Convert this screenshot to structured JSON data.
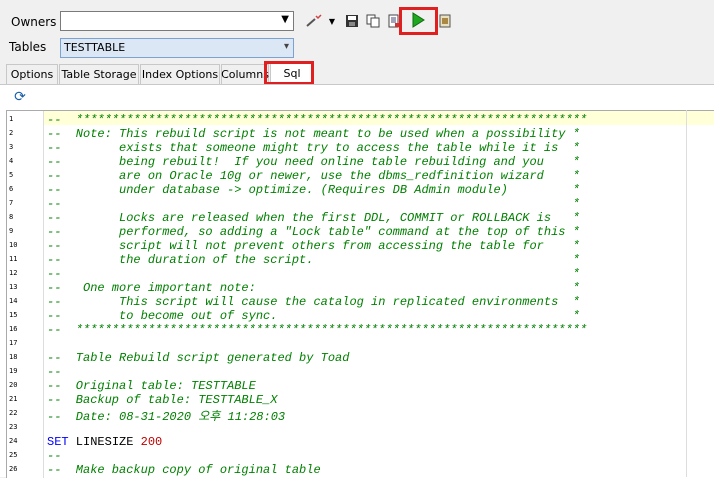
{
  "owners": {
    "label": "Owners",
    "value": ""
  },
  "tables": {
    "label": "Tables",
    "value": "TESTTABLE"
  },
  "tabs": [
    {
      "label": "Options"
    },
    {
      "label": "Table Storage"
    },
    {
      "label": "Index Options"
    },
    {
      "label": "Columns"
    },
    {
      "label": "Sql"
    }
  ],
  "active_tab": "Sql",
  "toolbar": {
    "icons": [
      "wand-icon",
      "dropdown-arrow-icon",
      "save-icon",
      "copy-icon",
      "document-icon",
      "run-icon",
      "close-icon"
    ],
    "run_color": "#1fa81f"
  },
  "refresh_icon": "refresh-icon",
  "highlight_color": "#e02020",
  "code_lines": [
    {
      "n": "1",
      "segs": [
        {
          "t": "--  ***********************************************************************",
          "c": "cmt"
        }
      ]
    },
    {
      "n": "2",
      "segs": [
        {
          "t": "--  Note: This rebuild script is not meant to be used when a possibility *",
          "c": "cmt"
        }
      ]
    },
    {
      "n": "3",
      "segs": [
        {
          "t": "--        exists that someone might try to access the table while it is  *",
          "c": "cmt"
        }
      ]
    },
    {
      "n": "4",
      "segs": [
        {
          "t": "--        being rebuilt!  If you need online table rebuilding and you    *",
          "c": "cmt"
        }
      ]
    },
    {
      "n": "5",
      "segs": [
        {
          "t": "--        are on Oracle 10g or newer, use the dbms_redfinition wizard    *",
          "c": "cmt"
        }
      ]
    },
    {
      "n": "6",
      "segs": [
        {
          "t": "--        under database -> optimize. (Requires DB Admin module)         *",
          "c": "cmt"
        }
      ]
    },
    {
      "n": "7",
      "segs": [
        {
          "t": "--                                                                       *",
          "c": "cmt"
        }
      ]
    },
    {
      "n": "8",
      "segs": [
        {
          "t": "--        Locks are released when the first DDL, COMMIT or ROLLBACK is   *",
          "c": "cmt"
        }
      ]
    },
    {
      "n": "9",
      "segs": [
        {
          "t": "--        performed, so adding a \"Lock table\" command at the top of this *",
          "c": "cmt"
        }
      ]
    },
    {
      "n": "10",
      "segs": [
        {
          "t": "--        script will not prevent others from accessing the table for    *",
          "c": "cmt"
        }
      ]
    },
    {
      "n": "11",
      "segs": [
        {
          "t": "--        the duration of the script.                                    *",
          "c": "cmt"
        }
      ]
    },
    {
      "n": "12",
      "segs": [
        {
          "t": "--                                                                       *",
          "c": "cmt"
        }
      ]
    },
    {
      "n": "13",
      "segs": [
        {
          "t": "--   One more important note:                                            *",
          "c": "cmt"
        }
      ]
    },
    {
      "n": "14",
      "segs": [
        {
          "t": "--        This script will cause the catalog in replicated environments  *",
          "c": "cmt"
        }
      ]
    },
    {
      "n": "15",
      "segs": [
        {
          "t": "--        to become out of sync.                                         *",
          "c": "cmt"
        }
      ]
    },
    {
      "n": "16",
      "segs": [
        {
          "t": "--  ***********************************************************************",
          "c": "cmt"
        }
      ]
    },
    {
      "n": "17",
      "segs": [
        {
          "t": "",
          "c": "plain"
        }
      ]
    },
    {
      "n": "18",
      "segs": [
        {
          "t": "--  Table Rebuild script generated by Toad",
          "c": "cmt"
        }
      ]
    },
    {
      "n": "19",
      "segs": [
        {
          "t": "--",
          "c": "cmt"
        }
      ]
    },
    {
      "n": "20",
      "segs": [
        {
          "t": "--  Original table: TESTTABLE",
          "c": "cmt"
        }
      ]
    },
    {
      "n": "21",
      "segs": [
        {
          "t": "--  Backup of table: TESTTABLE_X",
          "c": "cmt"
        }
      ]
    },
    {
      "n": "22",
      "segs": [
        {
          "t": "--  Date: 08-31-2020 오후 11:28:03",
          "c": "cmt"
        }
      ]
    },
    {
      "n": "23",
      "segs": [
        {
          "t": "",
          "c": "plain"
        }
      ]
    },
    {
      "n": "24",
      "segs": [
        {
          "t": "SET",
          "c": "kw"
        },
        {
          "t": " LINESIZE ",
          "c": "plain"
        },
        {
          "t": "200",
          "c": "num"
        }
      ]
    },
    {
      "n": "25",
      "segs": [
        {
          "t": "--",
          "c": "cmt"
        }
      ]
    },
    {
      "n": "26",
      "segs": [
        {
          "t": "--  Make backup copy of original table",
          "c": "cmt"
        }
      ]
    }
  ]
}
